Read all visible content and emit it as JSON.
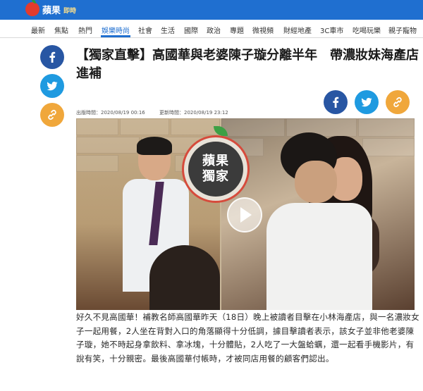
{
  "brand": {
    "name": "蘋果",
    "sub": "即時"
  },
  "nav": {
    "items": [
      "最新",
      "焦點",
      "熱門",
      "娛樂時尚",
      "社會",
      "生活",
      "國際",
      "政治",
      "專題",
      "微視頻",
      "財經地產",
      "3C車市",
      "吃喝玩樂",
      "親子寵物"
    ],
    "active_index": 3
  },
  "article": {
    "title": "【獨家直擊】高國華與老婆陳子璇分離半年　帶濃妝妹海產店進補",
    "published_label": "出版時間：",
    "published": "2020/08/19 00:16",
    "updated_label": "更新時間：",
    "updated": "2020/08/19 23:12",
    "badge_line1": "蘋果",
    "badge_line2": "獨家",
    "body": "好久不見高國華！補教名師高國華昨天（18日）晚上被讀者目擊在小林海產店，與一名濃妝女子一起用餐，2人坐在背對入口的角落顯得十分低調，據目擊讀者表示，該女子並非他老婆陳子璇，她不時起身拿飲料、拿冰塊，十分體貼，2人吃了一大盤蛤蠣，還一起看手機影片，有說有笑，十分親密。最後高國華付帳時，才被同店用餐的顧客們認出。"
  },
  "share": {
    "facebook_icon": "facebook-icon",
    "twitter_icon": "twitter-icon",
    "link_icon": "link-icon"
  },
  "colors": {
    "brand_blue": "#1f6fd0",
    "facebook": "#2856a3",
    "twitter": "#1f9ae0",
    "link": "#f0a73b"
  }
}
